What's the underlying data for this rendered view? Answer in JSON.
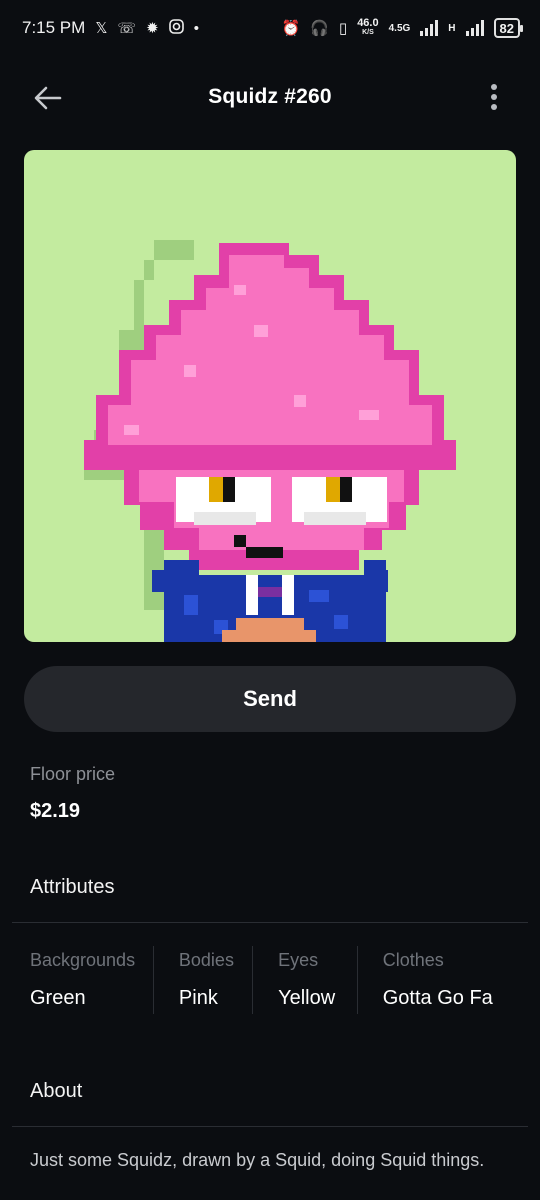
{
  "status_bar": {
    "time": "7:15 PM",
    "net_speed": "46.0",
    "net_unit": "K/S",
    "network_type": "4.5G",
    "signal2_type": "H",
    "battery": "82",
    "left_icons": [
      "x-logo-icon",
      "missed-call-icon",
      "settings-gear-icon",
      "instagram-icon",
      "dot-icon"
    ],
    "right_icons": [
      "alarm-icon",
      "headphones-icon",
      "battery-saver-icon"
    ]
  },
  "header": {
    "title": "Squidz #260"
  },
  "nft": {
    "background_color": "#c3eb9f"
  },
  "actions": {
    "send_label": "Send"
  },
  "floor": {
    "label": "Floor price",
    "value": "$2.19"
  },
  "attributes": {
    "title": "Attributes",
    "items": [
      {
        "label": "Backgrounds",
        "value": "Green"
      },
      {
        "label": "Bodies",
        "value": "Pink"
      },
      {
        "label": "Eyes",
        "value": "Yellow"
      },
      {
        "label": "Clothes",
        "value": "Gotta Go Fa"
      }
    ]
  },
  "about": {
    "title": "About",
    "text": "Just some Squidz, drawn by a Squid, doing Squid things."
  }
}
